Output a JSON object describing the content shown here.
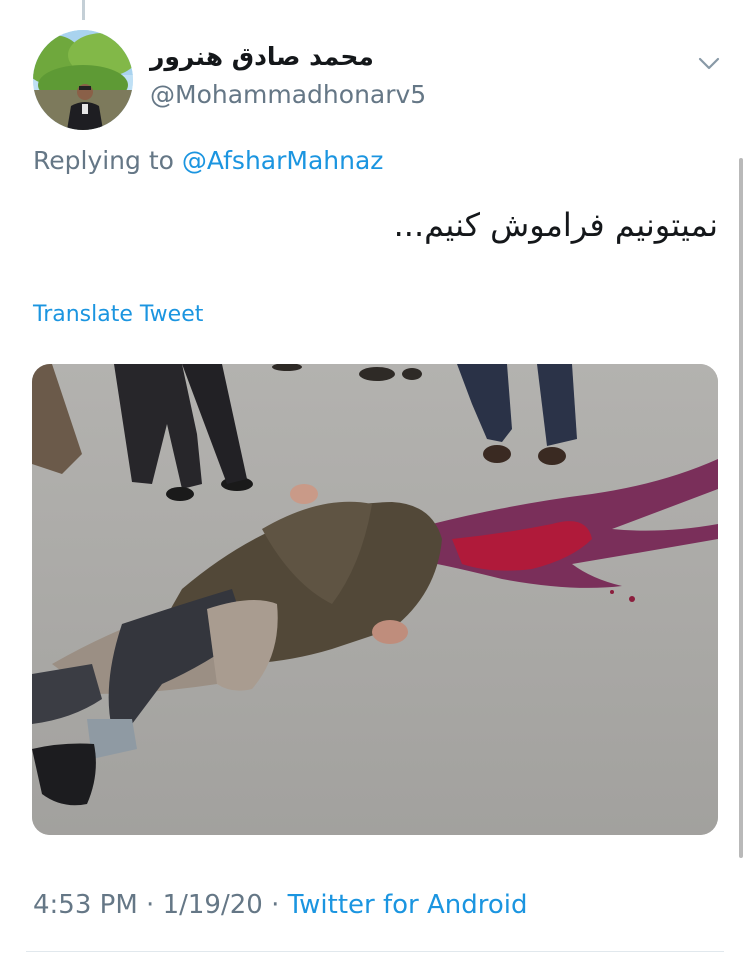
{
  "tweet": {
    "author": {
      "display_name": "محمد صادق هنرور",
      "handle": "@Mohammadhonarv5",
      "avatar_icon": "profile-photo"
    },
    "reply_prefix": "Replying to",
    "reply_to": "@AfsharMahnaz",
    "text": "نمیتونیم فراموش کنیم...",
    "translate_label": "Translate Tweet",
    "media_description_icon": "photo",
    "time": "4:53 PM",
    "date": "1/19/20",
    "source": "Twitter for Android",
    "separator": "·"
  },
  "colors": {
    "link": "#1b95e0",
    "secondary_text": "#657786",
    "primary_text": "#14171a",
    "divider": "#e1e8ed"
  }
}
